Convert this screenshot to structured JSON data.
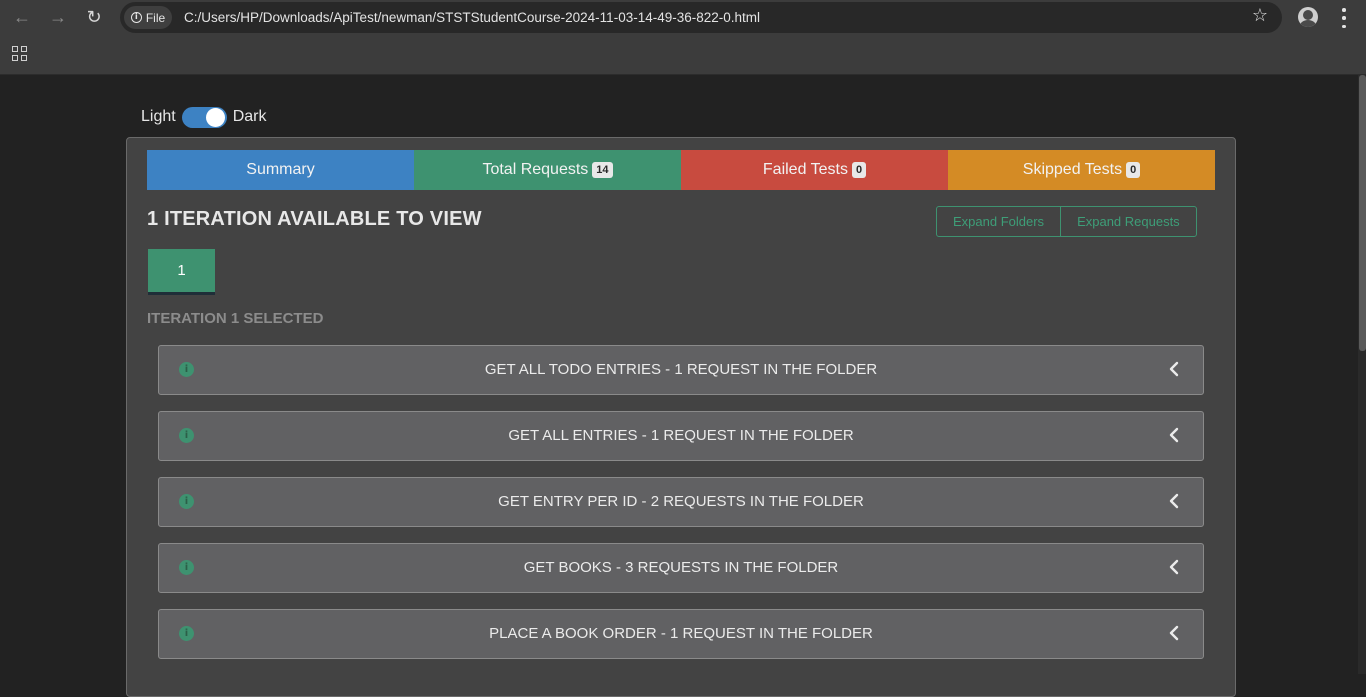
{
  "browser": {
    "site_chip_label": "File",
    "url": "C:/Users/HP/Downloads/ApiTest/newman/STSTStudentCourse-2024-11-03-14-49-36-822-0.html"
  },
  "theme": {
    "light_label": "Light",
    "dark_label": "Dark",
    "dark_enabled": true
  },
  "tabs": [
    {
      "label": "Summary",
      "count": null,
      "color": "#3d82c3"
    },
    {
      "label": "Total Requests",
      "count": "14",
      "color": "#3e9270"
    },
    {
      "label": "Failed Tests",
      "count": "0",
      "color": "#c84b3f"
    },
    {
      "label": "Skipped Tests",
      "count": "0",
      "color": "#d48b25"
    }
  ],
  "iterations": {
    "title": "1 ITERATION AVAILABLE TO VIEW",
    "expand_folders_label": "Expand Folders",
    "expand_requests_label": "Expand Requests",
    "buttons": [
      "1"
    ],
    "selected_label": "ITERATION 1 SELECTED"
  },
  "folders": [
    {
      "title": "GET ALL TODO ENTRIES - 1 REQUEST IN THE FOLDER",
      "icon": "info-icon"
    },
    {
      "title": "GET ALL ENTRIES - 1 REQUEST IN THE FOLDER",
      "icon": "info-icon"
    },
    {
      "title": "GET ENTRY PER ID - 2 REQUESTS IN THE FOLDER",
      "icon": "info-icon"
    },
    {
      "title": "GET BOOKS - 3 REQUESTS IN THE FOLDER",
      "icon": "info-icon"
    },
    {
      "title": "PLACE A BOOK ORDER - 1 REQUEST IN THE FOLDER",
      "icon": "info-icon"
    }
  ]
}
